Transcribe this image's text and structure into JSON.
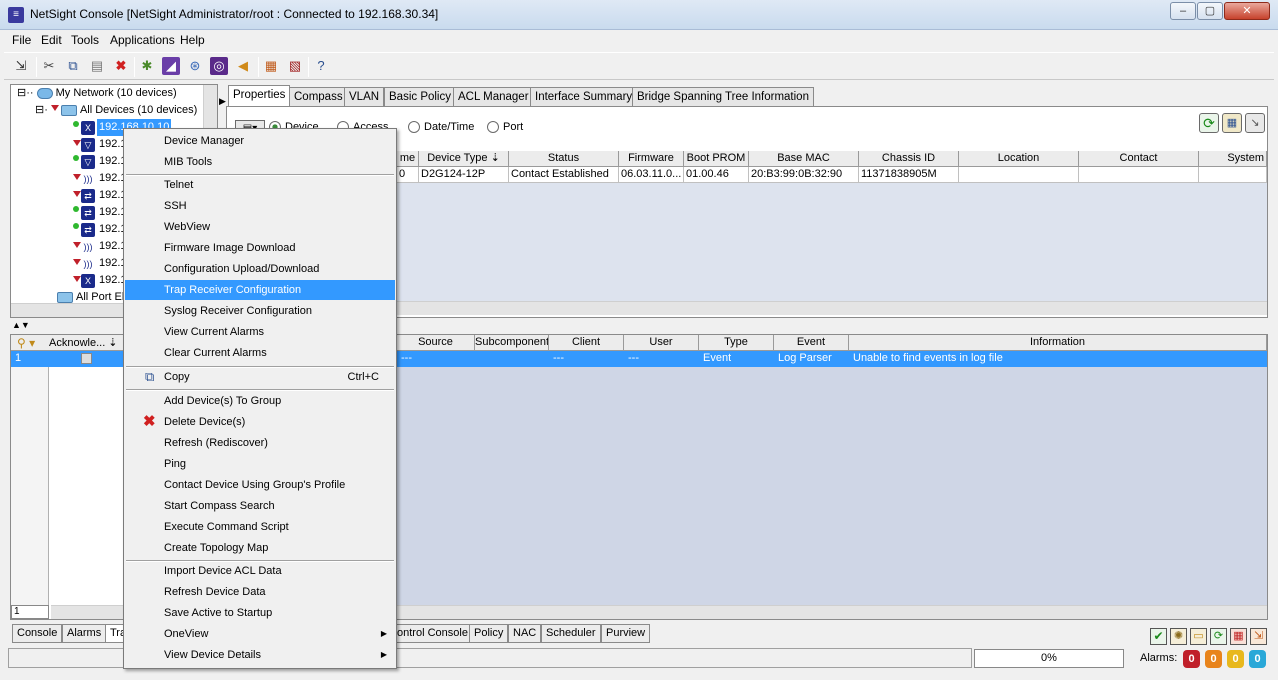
{
  "window": {
    "title": "NetSight Console [NetSight Administrator/root : Connected to 192.168.30.34]"
  },
  "menu": [
    "File",
    "Edit",
    "Tools",
    "Applications",
    "Help"
  ],
  "tree": {
    "root": "My Network (10 devices)",
    "all_devices": "All Devices (10 devices)",
    "selected_device": "192.168.10.10",
    "device_prefix": "192.1",
    "all_port": "All Port El"
  },
  "tabs": [
    "Properties",
    "Compass",
    "VLAN",
    "Basic Policy",
    "ACL Manager",
    "Interface Summary",
    "Bridge Spanning Tree Information"
  ],
  "view_options": {
    "device": "Device",
    "access": "Access",
    "datetime": "Date/Time",
    "port": "Port"
  },
  "device_table": {
    "columns": [
      "me",
      "Device Type",
      "Status",
      "Firmware",
      "Boot PROM",
      "Base MAC",
      "Chassis ID",
      "Location",
      "Contact",
      "System"
    ],
    "rows": [
      [
        "0",
        "D2G124-12P",
        "Contact Established",
        "06.03.11.0...",
        "01.00.46",
        "20:B3:99:0B:32:90",
        "11371838905M",
        "",
        "",
        ""
      ]
    ]
  },
  "events": {
    "ack_header": "Acknowle...",
    "columns": [
      "Source",
      "Subcomponent",
      "Client",
      "User",
      "Type",
      "Event",
      "Information"
    ],
    "row_index": "1",
    "rows": [
      [
        "---",
        "",
        "---",
        "---",
        "Event",
        "Log Parser",
        "Unable to find events in log file"
      ]
    ],
    "bottom_index": "1"
  },
  "bottom_tabs": [
    "Console",
    "Alarms",
    "Tra",
    "ontrol Console",
    "Policy",
    "NAC",
    "Scheduler",
    "Purview"
  ],
  "context_menu": {
    "items": [
      "Device Manager",
      "MIB Tools",
      "Telnet",
      "SSH",
      "WebView",
      "Firmware Image Download",
      "Configuration Upload/Download",
      "Trap Receiver Configuration",
      "Syslog Receiver Configuration",
      "View Current Alarms",
      "Clear Current Alarms",
      "Copy",
      "Add Device(s) To Group",
      "Delete Device(s)",
      "Refresh (Rediscover)",
      "Ping",
      "Contact Device Using Group's Profile",
      "Start Compass Search",
      "Execute Command Script",
      "Create Topology Map",
      "Import Device ACL Data",
      "Refresh Device Data",
      "Save Active to Startup",
      "OneView",
      "View Device Details"
    ],
    "copy_shortcut": "Ctrl+C",
    "highlighted": "Trap Receiver Configuration"
  },
  "status": {
    "progress": "0%",
    "alarms_label": "Alarms:",
    "alarm_counts": [
      "0",
      "0",
      "0",
      "0"
    ],
    "alarm_colors": [
      "#c0202a",
      "#e8841c",
      "#e8b81c",
      "#2aa8d8"
    ]
  }
}
